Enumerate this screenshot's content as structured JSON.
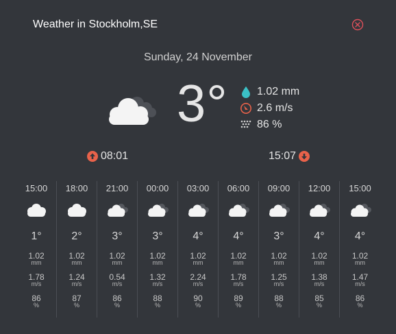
{
  "header": {
    "title": "Weather in Stockholm,SE"
  },
  "date": "Sunday, 24 November",
  "current": {
    "icon": "cloud-icon",
    "temperature": "3°",
    "precipitation": "1.02 mm",
    "wind": "2.6 m/s",
    "humidity": "86 %"
  },
  "sun": {
    "sunrise": "08:01",
    "sunset": "15:07"
  },
  "colors": {
    "background": "#33363b",
    "accent": "#e8624a",
    "drop": "#3bc1c6"
  },
  "forecast": [
    {
      "time": "15:00",
      "icon": "cloud-icon",
      "temp": "1°",
      "precip": "1.02",
      "precip_unit": "mm",
      "wind": "1.78",
      "wind_unit": "m/s",
      "humidity": "86",
      "humidity_unit": "%"
    },
    {
      "time": "18:00",
      "icon": "cloud-icon",
      "temp": "2°",
      "precip": "1.02",
      "precip_unit": "mm",
      "wind": "1.24",
      "wind_unit": "m/s",
      "humidity": "87",
      "humidity_unit": "%"
    },
    {
      "time": "21:00",
      "icon": "clouds-icon",
      "temp": "3°",
      "precip": "1.02",
      "precip_unit": "mm",
      "wind": "0.54",
      "wind_unit": "m/s",
      "humidity": "86",
      "humidity_unit": "%"
    },
    {
      "time": "00:00",
      "icon": "clouds-icon",
      "temp": "3°",
      "precip": "1.02",
      "precip_unit": "mm",
      "wind": "1.32",
      "wind_unit": "m/s",
      "humidity": "88",
      "humidity_unit": "%"
    },
    {
      "time": "03:00",
      "icon": "clouds-icon",
      "temp": "4°",
      "precip": "1.02",
      "precip_unit": "mm",
      "wind": "2.24",
      "wind_unit": "m/s",
      "humidity": "90",
      "humidity_unit": "%"
    },
    {
      "time": "06:00",
      "icon": "clouds-icon",
      "temp": "4°",
      "precip": "1.02",
      "precip_unit": "mm",
      "wind": "1.78",
      "wind_unit": "m/s",
      "humidity": "89",
      "humidity_unit": "%"
    },
    {
      "time": "09:00",
      "icon": "clouds-icon",
      "temp": "3°",
      "precip": "1.02",
      "precip_unit": "mm",
      "wind": "1.25",
      "wind_unit": "m/s",
      "humidity": "88",
      "humidity_unit": "%"
    },
    {
      "time": "12:00",
      "icon": "clouds-icon",
      "temp": "4°",
      "precip": "1.02",
      "precip_unit": "mm",
      "wind": "1.38",
      "wind_unit": "m/s",
      "humidity": "85",
      "humidity_unit": "%"
    },
    {
      "time": "15:00",
      "icon": "clouds-icon",
      "temp": "4°",
      "precip": "1.02",
      "precip_unit": "mm",
      "wind": "1.47",
      "wind_unit": "m/s",
      "humidity": "86",
      "humidity_unit": "%"
    }
  ]
}
